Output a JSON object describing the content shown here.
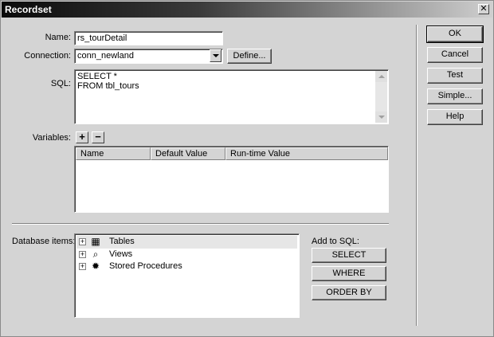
{
  "window": {
    "title": "Recordset",
    "close_glyph": "✕"
  },
  "form": {
    "name_label": "Name:",
    "name_value": "rs_tourDetail",
    "connection_label": "Connection:",
    "connection_value": "conn_newland",
    "define_button": "Define...",
    "sql_label": "SQL:",
    "sql_lines": [
      "SELECT *",
      "FROM tbl_tours"
    ],
    "variables_label": "Variables:",
    "add_variable_glyph": "+",
    "remove_variable_glyph": "−",
    "variables_columns": [
      "Name",
      "Default Value",
      "Run-time Value"
    ],
    "variables_rows": []
  },
  "database": {
    "label": "Database items:",
    "items": [
      {
        "label": "Tables",
        "icon": "table-icon",
        "expander": "+"
      },
      {
        "label": "Views",
        "icon": "view-icon",
        "expander": "+"
      },
      {
        "label": "Stored Procedures",
        "icon": "stored-procedure-icon",
        "expander": "+"
      }
    ],
    "add_to_sql_label": "Add to SQL:",
    "select_button": "SELECT",
    "where_button": "WHERE",
    "orderby_button": "ORDER BY"
  },
  "actions": {
    "ok": "OK",
    "cancel": "Cancel",
    "test": "Test",
    "simple": "Simple...",
    "help": "Help"
  }
}
